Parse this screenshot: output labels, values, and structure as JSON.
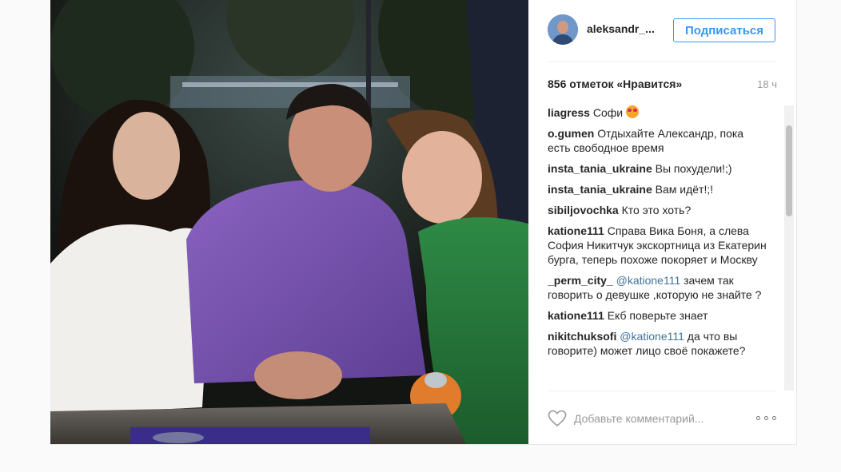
{
  "post": {
    "author": {
      "username": "aleksandr_...",
      "follow_label": "Подписаться"
    },
    "likes_text": "856 отметок «Нравится»",
    "time_ago": "18 ч",
    "comments": [
      {
        "user": "liagress",
        "text": "Софи",
        "emoji": "heart-eyes-emoji"
      },
      {
        "user": "o.gumen",
        "text": "Отдыхайте Александр, пока есть свободное время"
      },
      {
        "user": "insta_tania_ukraine",
        "text": "Вы похудели!;)"
      },
      {
        "user": "insta_tania_ukraine",
        "text": "Вам идёт!;!"
      },
      {
        "user": "sibiljovochka",
        "text": "Кто это хоть?"
      },
      {
        "user": "katione111",
        "text": "Справа Вика Боня, а слева София Никитчук экскортница из Екатерин бурга, теперь похоже покоряет и Москву"
      },
      {
        "user": "_perm_city_",
        "mention": "@katione111",
        "text": "зачем так говорить о девушке ,которую не знайте ?"
      },
      {
        "user": "katione111",
        "text": "Екб поверьте знает"
      },
      {
        "user": "nikitchuksofi",
        "mention": "@katione111",
        "text": "да что вы говорите) может лицо своё покажете?"
      }
    ],
    "comment_placeholder": "Добавьте комментарий..."
  },
  "colors": {
    "accent": "#3897f0",
    "text": "#262626",
    "muted": "#999999",
    "mention": "#3f729b"
  }
}
